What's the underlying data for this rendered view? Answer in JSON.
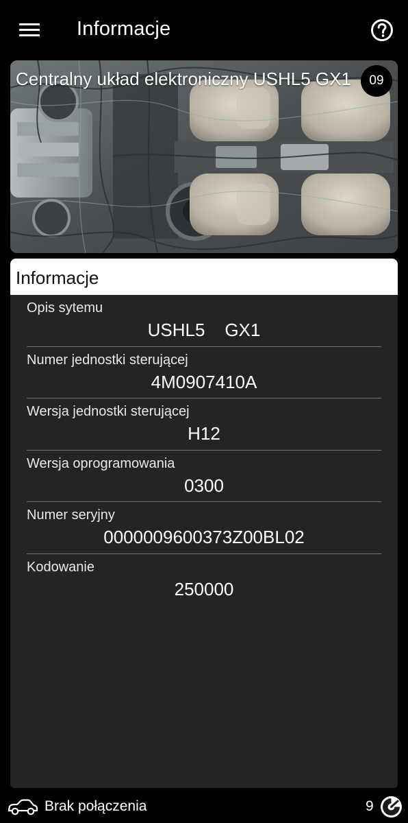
{
  "header": {
    "title": "Informacje",
    "menu_icon": "hamburger-menu-icon",
    "help_icon": "help-circle-icon"
  },
  "hero": {
    "title": "Centralny układ elektroniczny USHL5    GX1",
    "badge": "09",
    "image": "car-interior-wiring-image"
  },
  "info": {
    "header": "Informacje",
    "rows": [
      {
        "label": "Opis sytemu",
        "value": "USHL5    GX1"
      },
      {
        "label": "Numer jednostki sterującej",
        "value": "4M0907410A"
      },
      {
        "label": "Wersja jednostki sterującej",
        "value": "H12"
      },
      {
        "label": "Wersja oprogramowania",
        "value": "0300"
      },
      {
        "label": "Numer seryjny",
        "value": "0000009600373Z00BL02"
      },
      {
        "label": "Kodowanie",
        "value": "250000"
      }
    ]
  },
  "status": {
    "connection": "Brak połączenia",
    "count": "9",
    "car_icon": "car-icon",
    "gauge_icon": "gauge-icon"
  },
  "colors": {
    "background": "#000000",
    "panel": "#242424",
    "panel_header": "#ffffff",
    "divider": "#707070"
  }
}
